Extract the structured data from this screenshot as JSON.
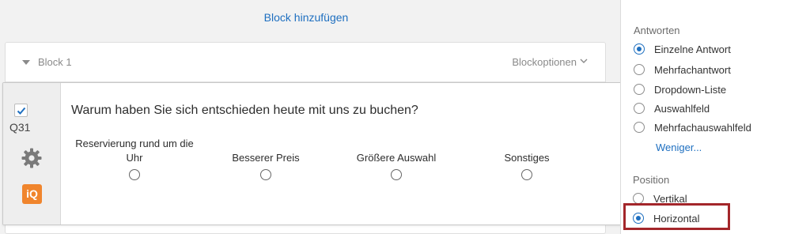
{
  "canvas": {
    "add_block": "Block hinzufügen"
  },
  "block": {
    "title": "Block 1",
    "options_label": "Blockoptionen"
  },
  "question": {
    "id": "Q31",
    "text": "Warum haben Sie sich entschieden heute mit uns zu buchen?",
    "iq_badge": "iQ",
    "checked": true,
    "choices": [
      {
        "line1": "Reservierung rund um die",
        "line2": "Uhr"
      },
      {
        "line1": "",
        "line2": "Besserer Preis"
      },
      {
        "line1": "",
        "line2": "Größere Auswahl"
      },
      {
        "line1": "",
        "line2": "Sonstiges"
      }
    ]
  },
  "panel": {
    "answers_heading": "Antworten",
    "answers": [
      {
        "label": "Einzelne Antwort",
        "selected": true
      },
      {
        "label": "Mehrfachantwort",
        "selected": false
      },
      {
        "label": "Dropdown-Liste",
        "selected": false
      },
      {
        "label": "Auswahlfeld",
        "selected": false
      },
      {
        "label": "Mehrfachauswahlfeld",
        "selected": false
      }
    ],
    "less_link": "Weniger...",
    "position_heading": "Position",
    "positions": [
      {
        "label": "Vertikal",
        "selected": false
      },
      {
        "label": "Horizontal",
        "selected": true
      }
    ]
  },
  "colors": {
    "accent": "#1e6fc0",
    "highlight": "#a3262a",
    "iq_orange": "#f0852d"
  }
}
